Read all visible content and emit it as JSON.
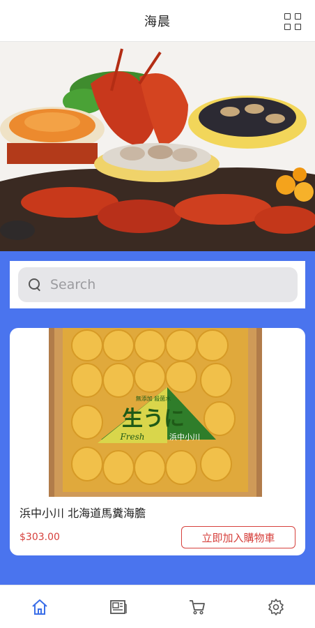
{
  "header": {
    "title": "海晨",
    "menu_icon": "grid-icon"
  },
  "hero": {
    "image": "seafood-platter-banner"
  },
  "search": {
    "placeholder": "Search",
    "value": "",
    "icon": "search-icon"
  },
  "products": [
    {
      "name": "浜中小川 北海道馬糞海膽",
      "price": "$303.00",
      "add_to_cart_label": "立即加入購物車",
      "image_label_main": "生うに",
      "image_label_sub": "Fresh",
      "image_label_brand": "浜中小川",
      "image_label_top": "無添加 殺菌水"
    }
  ],
  "tabbar": {
    "items": [
      {
        "name": "home",
        "icon": "home-icon",
        "active": true
      },
      {
        "name": "orders",
        "icon": "news-icon",
        "active": false
      },
      {
        "name": "cart",
        "icon": "cart-icon",
        "active": false
      },
      {
        "name": "settings",
        "icon": "gear-icon",
        "active": false
      }
    ]
  },
  "colors": {
    "accent": "#4a74ee",
    "price": "#d6403c",
    "tab_active": "#3a6ee8",
    "tab_inactive": "#555555"
  }
}
